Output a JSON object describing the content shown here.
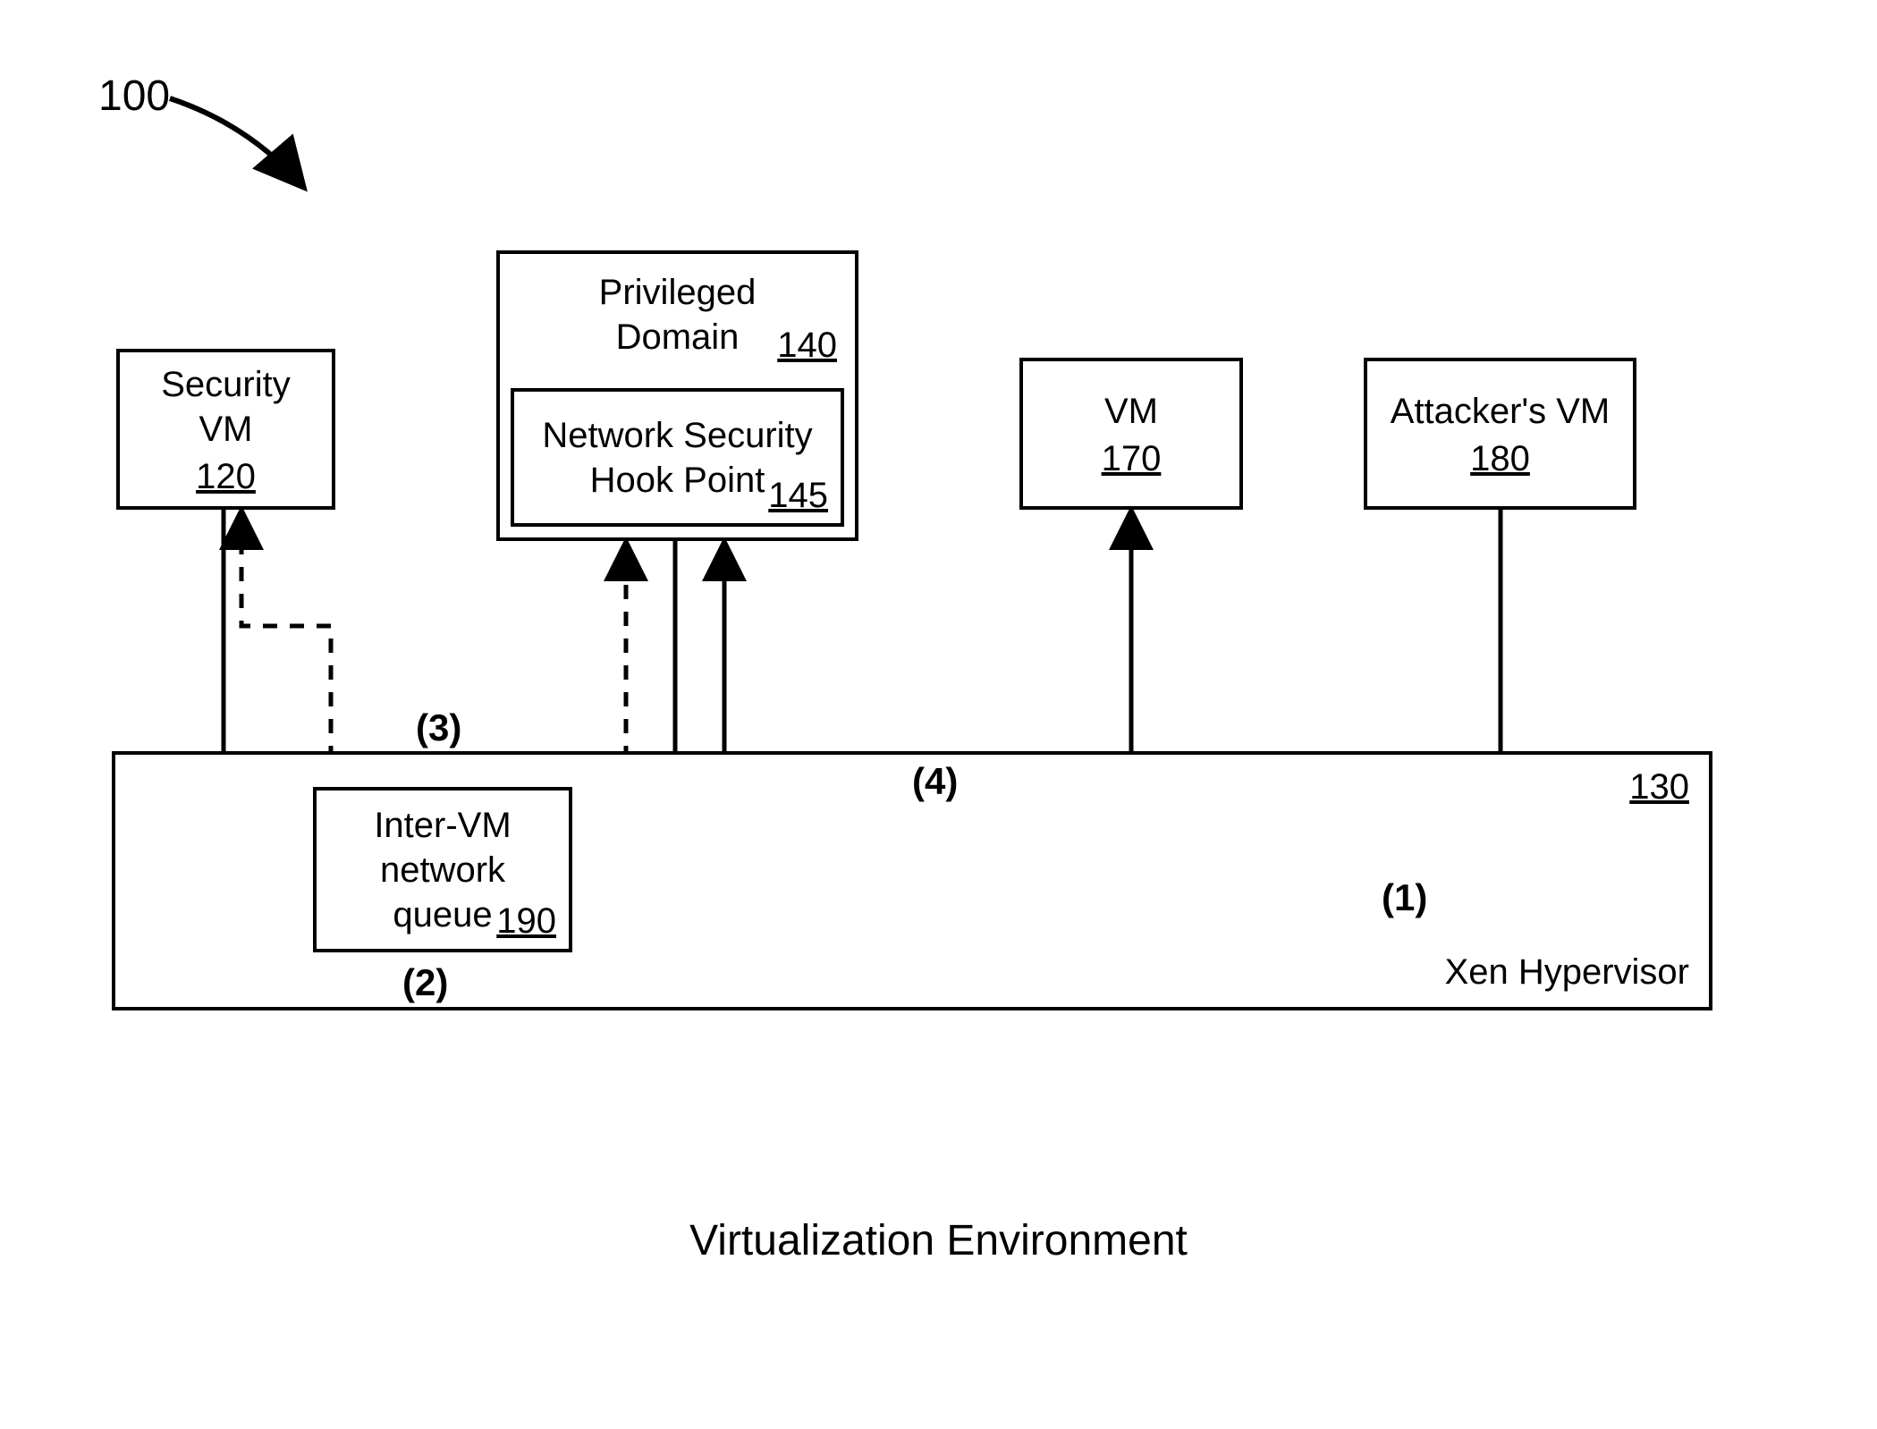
{
  "figure_number": "100",
  "boxes": {
    "security_vm": {
      "label": "Security\nVM",
      "ref": "120"
    },
    "priv_domain": {
      "label": "Privileged\nDomain",
      "ref": "140"
    },
    "hook_point": {
      "label": "Network Security\nHook Point",
      "ref": "145"
    },
    "vm": {
      "label": "VM",
      "ref": "170"
    },
    "attacker": {
      "label": "Attacker's VM",
      "ref": "180"
    },
    "queue": {
      "label": "Inter-VM\nnetwork\nqueue",
      "ref": "190"
    },
    "hypervisor": {
      "label": "Xen Hypervisor",
      "ref": "130"
    }
  },
  "flows": {
    "one": "(1)",
    "two": "(2)",
    "three": "(3)",
    "four": "(4)"
  },
  "caption": "Virtualization Environment"
}
